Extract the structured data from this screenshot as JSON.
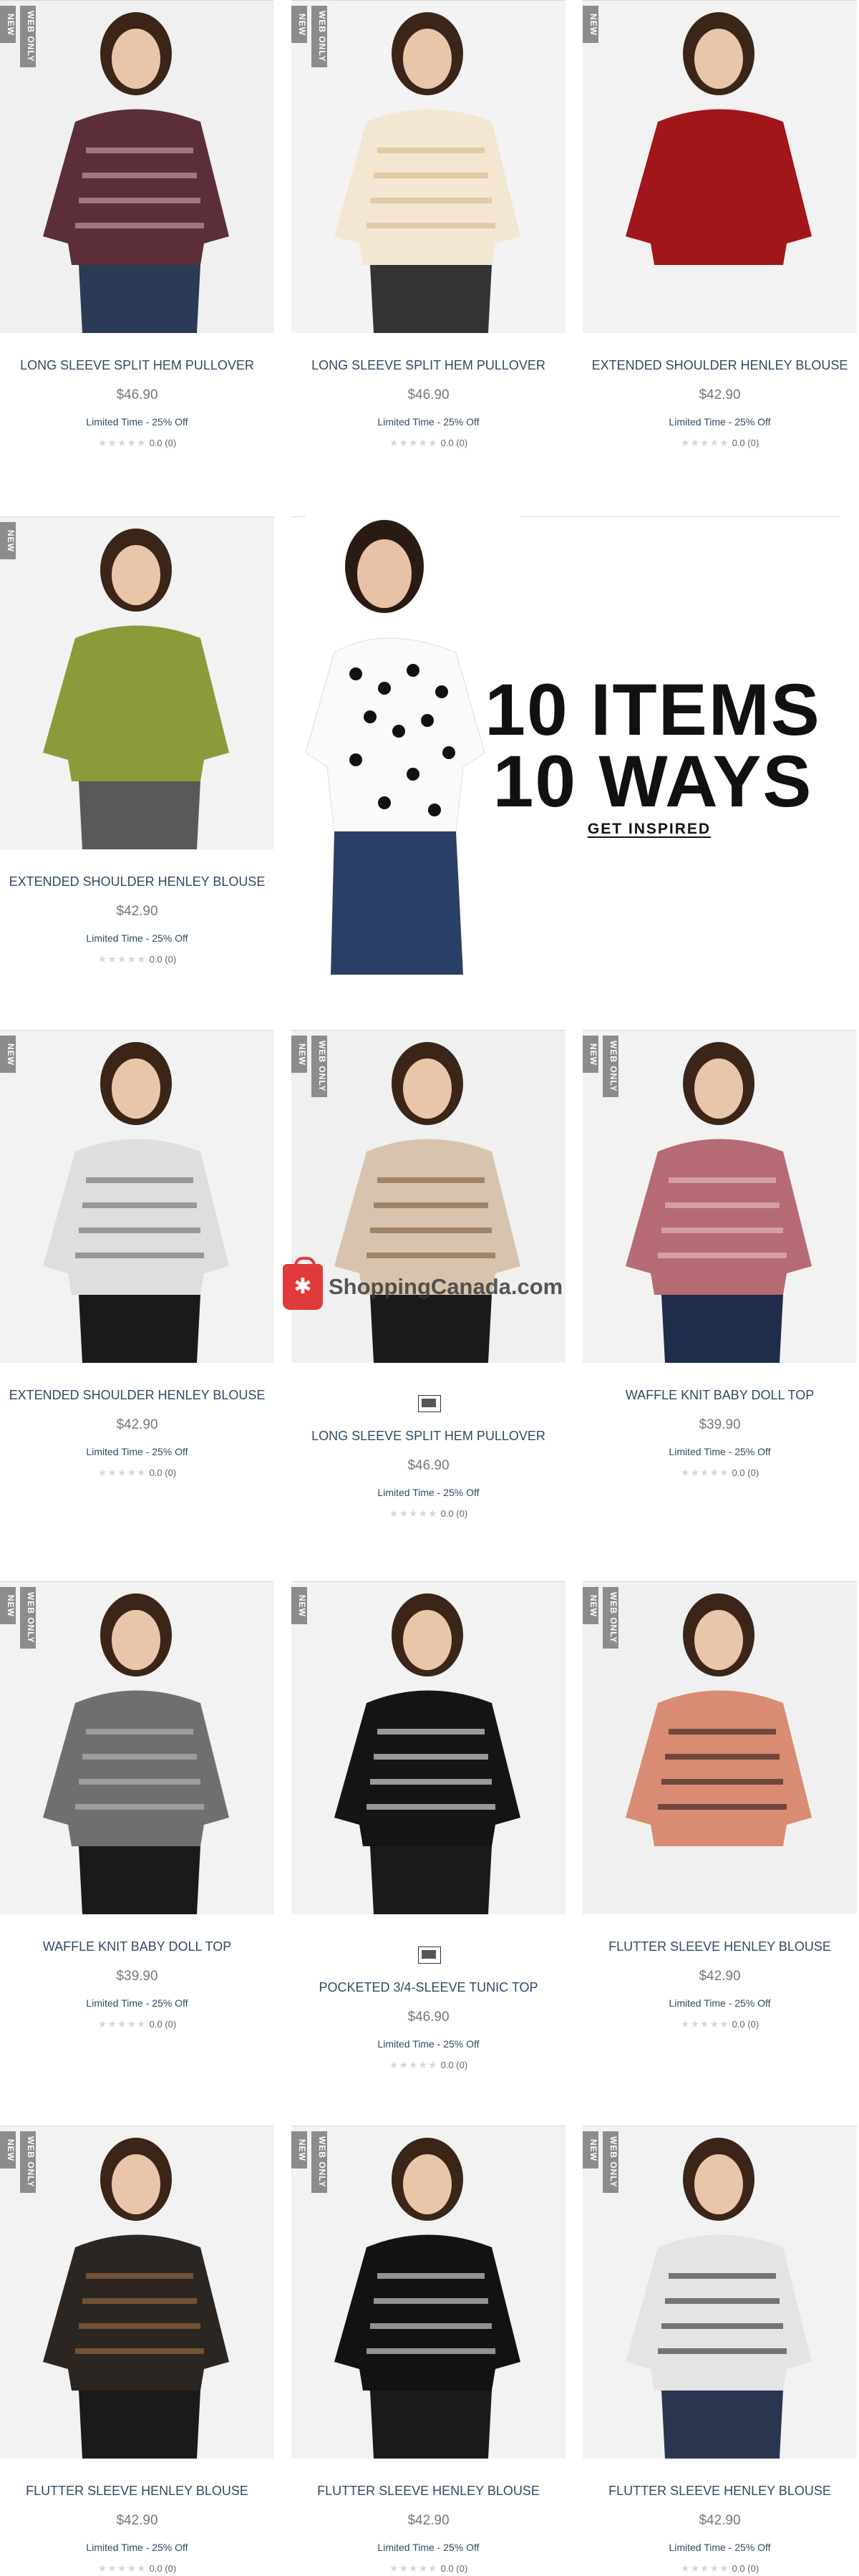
{
  "badges": {
    "new": "NEW",
    "web": "WEB ONLY"
  },
  "promo": {
    "line1": "10 ITEMS",
    "line2": "10 WAYS",
    "cta": "GET INSPIRED"
  },
  "watermark": "ShoppingCanada.com",
  "products": [
    {
      "name": "LONG SLEEVE SPLIT HEM PULLOVER",
      "price": "$46.90",
      "promo": "Limited Time - 25% Off",
      "rating": "0.0 (0)",
      "badges": [
        "new",
        "web"
      ],
      "colors": {
        "bg": "#f0f0f0",
        "top": "#5b2e3a",
        "stripe": "#cfa7ae",
        "bottom": "#2b3a55"
      }
    },
    {
      "name": "LONG SLEEVE SPLIT HEM PULLOVER",
      "price": "$46.90",
      "promo": "Limited Time - 25% Off",
      "rating": "0.0 (0)",
      "badges": [
        "new",
        "web"
      ],
      "colors": {
        "bg": "#f3f3f3",
        "top": "#f3e6d2",
        "stripe": "#d8b98c",
        "bottom": "#333333"
      }
    },
    {
      "name": "EXTENDED SHOULDER HENLEY BLOUSE",
      "price": "$42.90",
      "promo": "Limited Time - 25% Off",
      "rating": "0.0 (0)",
      "badges": [
        "new"
      ],
      "colors": {
        "bg": "#f2f2f2",
        "top": "#a1161b",
        "stripe": "#a1161b",
        "bottom": "#f2f2f2"
      }
    },
    {
      "name": "EXTENDED SHOULDER HENLEY BLOUSE",
      "price": "$42.90",
      "promo": "Limited Time - 25% Off",
      "rating": "0.0 (0)",
      "badges": [
        "new"
      ],
      "colors": {
        "bg": "#f2f2f2",
        "top": "#8d9a3a",
        "stripe": "#8d9a3a",
        "bottom": "#595959"
      }
    },
    {
      "name": "EXTENDED SHOULDER HENLEY BLOUSE",
      "price": "$42.90",
      "promo": "Limited Time - 25% Off",
      "rating": "0.0 (0)",
      "badges": [
        "new"
      ],
      "colors": {
        "bg": "#f2f2f2",
        "top": "#dedede",
        "stripe": "#6b6b6b",
        "bottom": "#1a1a1a"
      }
    },
    {
      "name": "LONG SLEEVE SPLIT HEM PULLOVER",
      "price": "$46.90",
      "promo": "Limited Time - 25% Off",
      "rating": "0.0 (0)",
      "badges": [
        "new",
        "web"
      ],
      "swatch": true,
      "colors": {
        "bg": "#f0f0f0",
        "top": "#d8c4ae",
        "stripe": "#7a5a3c",
        "bottom": "#1a1a1a"
      }
    },
    {
      "name": "WAFFLE KNIT BABY DOLL TOP",
      "price": "$39.90",
      "promo": "Limited Time - 25% Off",
      "rating": "0.0 (0)",
      "badges": [
        "new",
        "web"
      ],
      "colors": {
        "bg": "#f2f2f2",
        "top": "#b66a73",
        "stripe": "#e7c3c7",
        "bottom": "#1f2c4a"
      }
    },
    {
      "name": "WAFFLE KNIT BABY DOLL TOP",
      "price": "$39.90",
      "promo": "Limited Time - 25% Off",
      "rating": "0.0 (0)",
      "badges": [
        "new",
        "web"
      ],
      "colors": {
        "bg": "#f2f2f2",
        "top": "#6f6f6f",
        "stripe": "#bdbdbd",
        "bottom": "#1a1a1a"
      }
    },
    {
      "name": "POCKETED 3/4-SLEEVE TUNIC TOP",
      "price": "$46.90",
      "promo": "Limited Time - 25% Off",
      "rating": "0.0 (0)",
      "badges": [
        "new"
      ],
      "swatch": true,
      "colors": {
        "bg": "#f2f2f2",
        "top": "#141414",
        "stripe": "#f2f2f2",
        "bottom": "#1a1a1a"
      }
    },
    {
      "name": "FLUTTER SLEEVE HENLEY BLOUSE",
      "price": "$42.90",
      "promo": "Limited Time - 25% Off",
      "rating": "0.0 (0)",
      "badges": [
        "new",
        "web"
      ],
      "colors": {
        "bg": "#f0f0f0",
        "top": "#d98c73",
        "stripe": "#2a1b18",
        "bottom": "#f0f0f0"
      }
    },
    {
      "name": "FLUTTER SLEEVE HENLEY BLOUSE",
      "price": "$42.90",
      "promo": "Limited Time - 25% Off",
      "rating": "0.0 (0)",
      "badges": [
        "new",
        "web"
      ],
      "colors": {
        "bg": "#f2f2f2",
        "top": "#2b2622",
        "stripe": "#a0703f",
        "bottom": "#1a1a1a"
      }
    },
    {
      "name": "FLUTTER SLEEVE HENLEY BLOUSE",
      "price": "$42.90",
      "promo": "Limited Time - 25% Off",
      "rating": "0.0 (0)",
      "badges": [
        "new",
        "web"
      ],
      "colors": {
        "bg": "#f2f2f2",
        "top": "#121212",
        "stripe": "#e8e8e8",
        "bottom": "#1a1a1a"
      }
    },
    {
      "name": "FLUTTER SLEEVE HENLEY BLOUSE",
      "price": "$42.90",
      "promo": "Limited Time - 25% Off",
      "rating": "0.0 (0)",
      "badges": [
        "new",
        "web"
      ],
      "colors": {
        "bg": "#f2f2f2",
        "top": "#e4e4e4",
        "stripe": "#2a2a2a",
        "bottom": "#2a3550"
      }
    }
  ]
}
